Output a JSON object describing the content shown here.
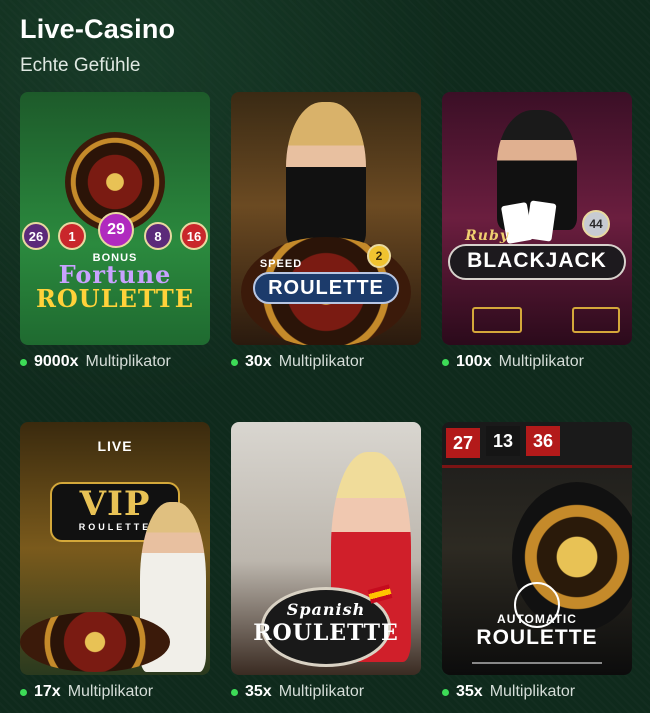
{
  "section": {
    "title": "Live-Casino",
    "subtitle": "Echte Gefühle"
  },
  "games": [
    {
      "art": {
        "line1": "Fortune",
        "line2": "ROULETTE",
        "pills": [
          "26",
          "1",
          "29",
          "8",
          "16"
        ],
        "bonus": "BONUS"
      },
      "multiplier": "9000x",
      "label": "Multiplikator"
    },
    {
      "art": {
        "line1": "SPEED",
        "line2": "ROULETTE",
        "badge": "2"
      },
      "multiplier": "30x",
      "label": "Multiplikator"
    },
    {
      "art": {
        "line1": "Ruby",
        "line2": "BLACKJACK",
        "badge": "44"
      },
      "multiplier": "100x",
      "label": "Multiplikator"
    },
    {
      "art": {
        "line1": "LIVE",
        "line2": "VIP",
        "line3": "ROULETTE"
      },
      "multiplier": "17x",
      "label": "Multiplikator"
    },
    {
      "art": {
        "line1": "Spanish",
        "line2": "ROULETTE"
      },
      "multiplier": "35x",
      "label": "Multiplikator"
    },
    {
      "art": {
        "line1": "AUTOMATIC",
        "line2": "ROULETTE",
        "numbers": [
          "27",
          "13",
          "36"
        ]
      },
      "multiplier": "35x",
      "label": "Multiplikator"
    }
  ],
  "colors": {
    "background": "#0f2a1c",
    "status_dot": "#3ddc57",
    "caption_text": "#d5ddd8"
  }
}
